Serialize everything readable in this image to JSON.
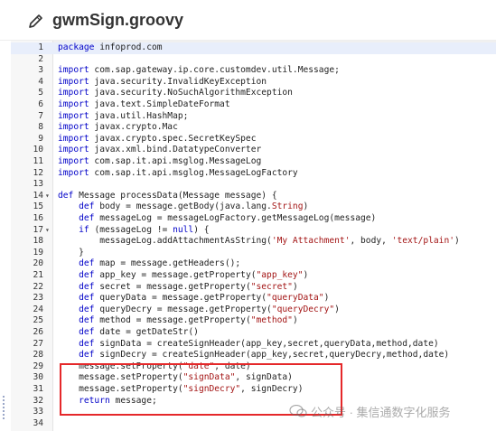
{
  "header": {
    "file_title": "gwmSign.groovy",
    "icon": "edit-icon"
  },
  "editor": {
    "active_line": 1,
    "lines": [
      {
        "n": "1",
        "fold": "",
        "segs": [
          {
            "t": "package",
            "c": "kw"
          },
          {
            "t": " infoprod.com",
            "c": ""
          }
        ]
      },
      {
        "n": "2",
        "fold": "",
        "segs": []
      },
      {
        "n": "3",
        "fold": "",
        "segs": [
          {
            "t": "import",
            "c": "kw"
          },
          {
            "t": " com.sap.gateway.ip.core.customdev.util.Message;",
            "c": ""
          }
        ]
      },
      {
        "n": "4",
        "fold": "",
        "segs": [
          {
            "t": "import",
            "c": "kw"
          },
          {
            "t": " java.security.InvalidKeyException",
            "c": ""
          }
        ]
      },
      {
        "n": "5",
        "fold": "",
        "segs": [
          {
            "t": "import",
            "c": "kw"
          },
          {
            "t": " java.security.NoSuchAlgorithmException",
            "c": ""
          }
        ]
      },
      {
        "n": "6",
        "fold": "",
        "segs": [
          {
            "t": "import",
            "c": "kw"
          },
          {
            "t": " java.text.SimpleDateFormat",
            "c": ""
          }
        ]
      },
      {
        "n": "7",
        "fold": "",
        "segs": [
          {
            "t": "import",
            "c": "kw"
          },
          {
            "t": " java.util.HashMap;",
            "c": ""
          }
        ]
      },
      {
        "n": "8",
        "fold": "",
        "segs": [
          {
            "t": "import",
            "c": "kw"
          },
          {
            "t": " javax.crypto.Mac",
            "c": ""
          }
        ]
      },
      {
        "n": "9",
        "fold": "",
        "segs": [
          {
            "t": "import",
            "c": "kw"
          },
          {
            "t": " javax.crypto.spec.SecretKeySpec",
            "c": ""
          }
        ]
      },
      {
        "n": "10",
        "fold": "",
        "segs": [
          {
            "t": "import",
            "c": "kw"
          },
          {
            "t": " javax.xml.bind.DatatypeConverter",
            "c": ""
          }
        ]
      },
      {
        "n": "11",
        "fold": "",
        "segs": [
          {
            "t": "import",
            "c": "kw"
          },
          {
            "t": " com.sap.it.api.msglog.MessageLog",
            "c": ""
          }
        ]
      },
      {
        "n": "12",
        "fold": "",
        "segs": [
          {
            "t": "import",
            "c": "kw"
          },
          {
            "t": " com.sap.it.api.msglog.MessageLogFactory",
            "c": ""
          }
        ]
      },
      {
        "n": "13",
        "fold": "",
        "segs": []
      },
      {
        "n": "14",
        "fold": "▾",
        "segs": [
          {
            "t": "def",
            "c": "kw"
          },
          {
            "t": " Message processData(Message message) {",
            "c": ""
          }
        ]
      },
      {
        "n": "15",
        "fold": "",
        "segs": [
          {
            "t": "    ",
            "c": ""
          },
          {
            "t": "def",
            "c": "kw"
          },
          {
            "t": " body = message.getBody(java.lang.",
            "c": ""
          },
          {
            "t": "String",
            "c": "str"
          },
          {
            "t": ")",
            "c": ""
          }
        ]
      },
      {
        "n": "16",
        "fold": "",
        "segs": [
          {
            "t": "    ",
            "c": ""
          },
          {
            "t": "def",
            "c": "kw"
          },
          {
            "t": " messageLog = messageLogFactory.getMessageLog(message)",
            "c": ""
          }
        ]
      },
      {
        "n": "17",
        "fold": "▾",
        "segs": [
          {
            "t": "    ",
            "c": ""
          },
          {
            "t": "if",
            "c": "kw"
          },
          {
            "t": " (messageLog != ",
            "c": ""
          },
          {
            "t": "null",
            "c": "kw"
          },
          {
            "t": ") {",
            "c": ""
          }
        ]
      },
      {
        "n": "18",
        "fold": "",
        "segs": [
          {
            "t": "        messageLog.addAttachmentAsString(",
            "c": ""
          },
          {
            "t": "'My Attachment'",
            "c": "str"
          },
          {
            "t": ", body, ",
            "c": ""
          },
          {
            "t": "'text/plain'",
            "c": "str"
          },
          {
            "t": ")",
            "c": ""
          }
        ]
      },
      {
        "n": "19",
        "fold": "",
        "segs": [
          {
            "t": "    }",
            "c": ""
          }
        ]
      },
      {
        "n": "20",
        "fold": "",
        "segs": [
          {
            "t": "    ",
            "c": ""
          },
          {
            "t": "def",
            "c": "kw"
          },
          {
            "t": " map = message.getHeaders();",
            "c": ""
          }
        ]
      },
      {
        "n": "21",
        "fold": "",
        "segs": [
          {
            "t": "    ",
            "c": ""
          },
          {
            "t": "def",
            "c": "kw"
          },
          {
            "t": " app_key = message.getProperty(",
            "c": ""
          },
          {
            "t": "\"app_key\"",
            "c": "str"
          },
          {
            "t": ")",
            "c": ""
          }
        ]
      },
      {
        "n": "22",
        "fold": "",
        "segs": [
          {
            "t": "    ",
            "c": ""
          },
          {
            "t": "def",
            "c": "kw"
          },
          {
            "t": " secret = message.getProperty(",
            "c": ""
          },
          {
            "t": "\"secret\"",
            "c": "str"
          },
          {
            "t": ")",
            "c": ""
          }
        ]
      },
      {
        "n": "23",
        "fold": "",
        "segs": [
          {
            "t": "    ",
            "c": ""
          },
          {
            "t": "def",
            "c": "kw"
          },
          {
            "t": " queryData = message.getProperty(",
            "c": ""
          },
          {
            "t": "\"queryData\"",
            "c": "str"
          },
          {
            "t": ")",
            "c": ""
          }
        ]
      },
      {
        "n": "24",
        "fold": "",
        "segs": [
          {
            "t": "    ",
            "c": ""
          },
          {
            "t": "def",
            "c": "kw"
          },
          {
            "t": " queryDecry = message.getProperty(",
            "c": ""
          },
          {
            "t": "\"queryDecry\"",
            "c": "str"
          },
          {
            "t": ")",
            "c": ""
          }
        ]
      },
      {
        "n": "25",
        "fold": "",
        "segs": [
          {
            "t": "    ",
            "c": ""
          },
          {
            "t": "def",
            "c": "kw"
          },
          {
            "t": " method = message.getProperty(",
            "c": ""
          },
          {
            "t": "\"method\"",
            "c": "str"
          },
          {
            "t": ")",
            "c": ""
          }
        ]
      },
      {
        "n": "26",
        "fold": "",
        "segs": [
          {
            "t": "    ",
            "c": ""
          },
          {
            "t": "def",
            "c": "kw"
          },
          {
            "t": " date = getDateStr()",
            "c": ""
          }
        ]
      },
      {
        "n": "27",
        "fold": "",
        "segs": [
          {
            "t": "    ",
            "c": ""
          },
          {
            "t": "def",
            "c": "kw"
          },
          {
            "t": " signData = createSignHeader(app_key,secret,queryData,method,date)",
            "c": ""
          }
        ]
      },
      {
        "n": "28",
        "fold": "",
        "segs": [
          {
            "t": "    ",
            "c": ""
          },
          {
            "t": "def",
            "c": "kw"
          },
          {
            "t": " signDecry = createSignHeader(app_key,secret,queryDecry,method,date)",
            "c": ""
          }
        ]
      },
      {
        "n": "29",
        "fold": "",
        "segs": [
          {
            "t": "    message.setProperty(",
            "c": ""
          },
          {
            "t": "\"date\"",
            "c": "str"
          },
          {
            "t": ", date)",
            "c": ""
          }
        ]
      },
      {
        "n": "30",
        "fold": "",
        "segs": [
          {
            "t": "    message.setProperty(",
            "c": ""
          },
          {
            "t": "\"signData\"",
            "c": "str"
          },
          {
            "t": ", signData)",
            "c": ""
          }
        ]
      },
      {
        "n": "31",
        "fold": "",
        "segs": [
          {
            "t": "    message.setProperty(",
            "c": ""
          },
          {
            "t": "\"signDecry\"",
            "c": "str"
          },
          {
            "t": ", signDecry)",
            "c": ""
          }
        ]
      },
      {
        "n": "32",
        "fold": "",
        "segs": [
          {
            "t": "    ",
            "c": ""
          },
          {
            "t": "return",
            "c": "kw"
          },
          {
            "t": " message;",
            "c": ""
          }
        ]
      },
      {
        "n": "33",
        "fold": "",
        "segs": []
      },
      {
        "n": "34",
        "fold": "",
        "segs": []
      }
    ]
  },
  "annotation": {
    "box_color": "#e5282a"
  },
  "watermark": {
    "text": "公众号 · 集信通数字化服务",
    "icon": "wechat-icon"
  },
  "colors": {
    "keyword": "#0000c8",
    "string": "#a31515",
    "active_line": "#e8eefb"
  }
}
